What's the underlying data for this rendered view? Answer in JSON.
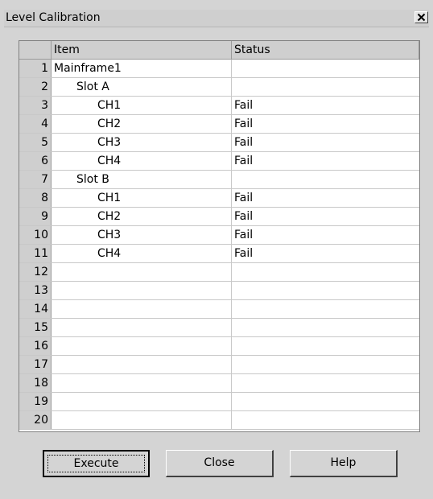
{
  "window": {
    "title": "Level Calibration"
  },
  "grid": {
    "headers": [
      "",
      "Item",
      "Status"
    ],
    "rows": [
      {
        "num": "1",
        "item": "Mainframe1",
        "indent": 0,
        "status": ""
      },
      {
        "num": "2",
        "item": "Slot A",
        "indent": 1,
        "status": ""
      },
      {
        "num": "3",
        "item": "CH1",
        "indent": 2,
        "status": "Fail"
      },
      {
        "num": "4",
        "item": "CH2",
        "indent": 2,
        "status": "Fail"
      },
      {
        "num": "5",
        "item": "CH3",
        "indent": 2,
        "status": "Fail"
      },
      {
        "num": "6",
        "item": "CH4",
        "indent": 2,
        "status": "Fail"
      },
      {
        "num": "7",
        "item": "Slot B",
        "indent": 1,
        "status": ""
      },
      {
        "num": "8",
        "item": "CH1",
        "indent": 2,
        "status": "Fail"
      },
      {
        "num": "9",
        "item": "CH2",
        "indent": 2,
        "status": "Fail"
      },
      {
        "num": "10",
        "item": "CH3",
        "indent": 2,
        "status": "Fail"
      },
      {
        "num": "11",
        "item": "CH4",
        "indent": 2,
        "status": "Fail"
      },
      {
        "num": "12",
        "item": "",
        "indent": 0,
        "status": ""
      },
      {
        "num": "13",
        "item": "",
        "indent": 0,
        "status": ""
      },
      {
        "num": "14",
        "item": "",
        "indent": 0,
        "status": ""
      },
      {
        "num": "15",
        "item": "",
        "indent": 0,
        "status": ""
      },
      {
        "num": "16",
        "item": "",
        "indent": 0,
        "status": ""
      },
      {
        "num": "17",
        "item": "",
        "indent": 0,
        "status": ""
      },
      {
        "num": "18",
        "item": "",
        "indent": 0,
        "status": ""
      },
      {
        "num": "19",
        "item": "",
        "indent": 0,
        "status": ""
      },
      {
        "num": "20",
        "item": "",
        "indent": 0,
        "status": ""
      }
    ]
  },
  "buttons": {
    "execute": "Execute",
    "close": "Close",
    "help": "Help"
  },
  "icons": {
    "close": "close-icon"
  }
}
